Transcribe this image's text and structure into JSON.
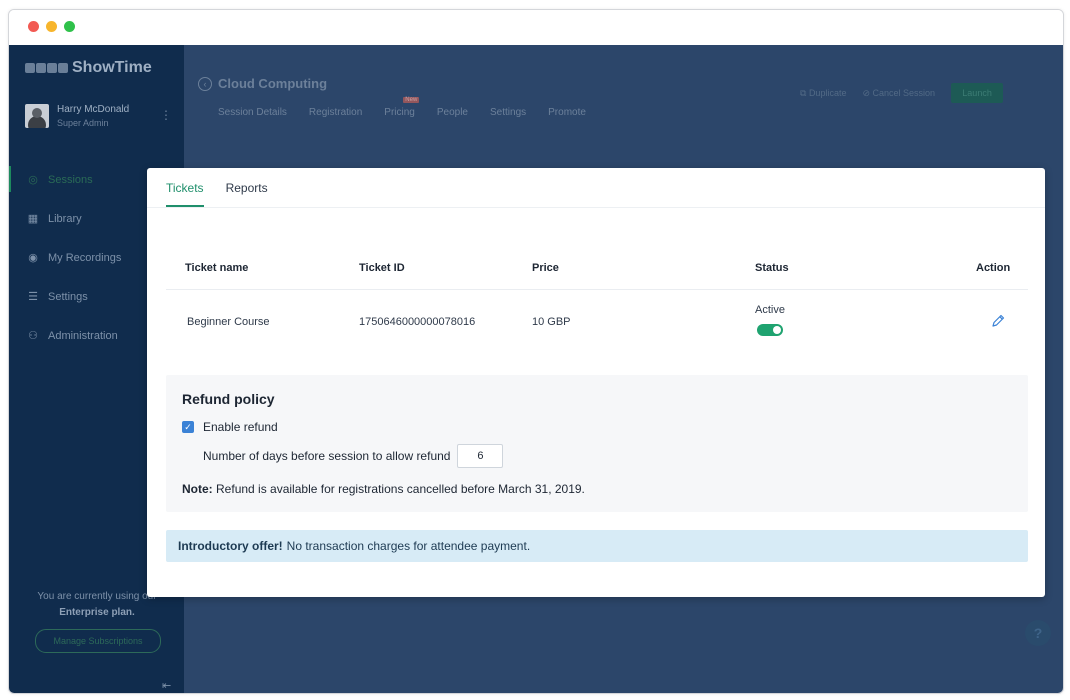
{
  "window": {
    "controls": [
      "close",
      "minimize",
      "maximize"
    ]
  },
  "sidebar": {
    "brand": "ShowTime",
    "user": {
      "name": "Harry McDonald",
      "role": "Super Admin"
    },
    "items": [
      {
        "label": "Sessions",
        "icon": "sessions-icon",
        "active": true
      },
      {
        "label": "Library",
        "icon": "library-icon"
      },
      {
        "label": "My Recordings",
        "icon": "recordings-icon"
      },
      {
        "label": "Settings",
        "icon": "settings-icon"
      },
      {
        "label": "Administration",
        "icon": "administration-icon"
      }
    ],
    "plan_text": "You are currently using our",
    "plan_name": "Enterprise plan.",
    "manage_label": "Manage Subscriptions"
  },
  "header": {
    "title": "Cloud Computing",
    "tabs": [
      "Session Details",
      "Registration",
      "Pricing",
      "People",
      "Settings",
      "Promote"
    ],
    "new_badge": "New",
    "duplicate_label": "Duplicate",
    "cancel_label": "Cancel Session",
    "launch_label": "Launch"
  },
  "modal": {
    "tabs": [
      "Tickets",
      "Reports"
    ],
    "active_tab": "Tickets",
    "columns": [
      "Ticket name",
      "Ticket ID",
      "Price",
      "Status",
      "Action"
    ],
    "ticket": {
      "name": "Beginner Course",
      "id": "1750646000000078016",
      "price": "10 GBP",
      "status": "Active",
      "status_on": true
    },
    "refund": {
      "title": "Refund policy",
      "enable_label": "Enable refund",
      "enabled": true,
      "days_label": "Number of days before session to allow refund",
      "days_value": "6",
      "note_label": "Note:",
      "note_text": "Refund is available for registrations cancelled before March 31, 2019."
    },
    "offer": {
      "bold": "Introductory offer!",
      "text": "No transaction charges for attendee payment."
    }
  },
  "help_label": "?",
  "colors": {
    "accent_green": "#1f8f6b",
    "sidebar_bg": "#102c4d",
    "overlay_bg": "#2c466a",
    "offer_bg": "#d7ebf6"
  }
}
